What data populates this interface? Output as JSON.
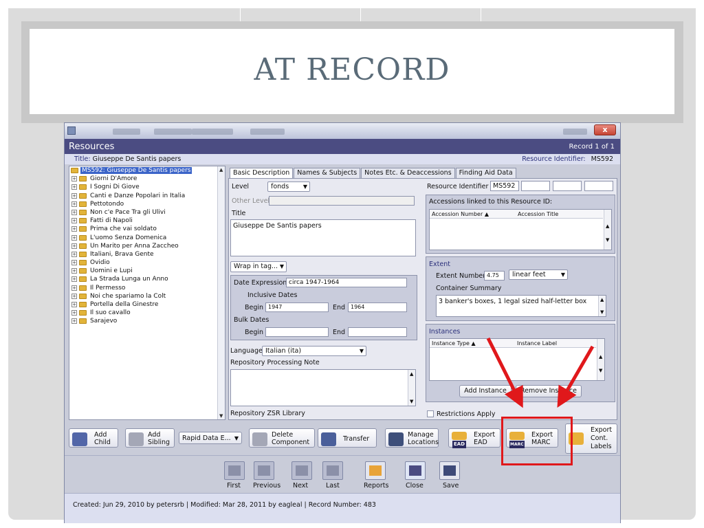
{
  "slide": {
    "title": "AT RECORD"
  },
  "window": {
    "header_title": "Resources",
    "record_indicator": "Record 1 of 1",
    "title_label": "Title:",
    "title_value": "Giuseppe De Santis papers",
    "resource_id_label": "Resource Identifier:",
    "resource_id_value": "MS592",
    "close_glyph": "x"
  },
  "tree": {
    "root": "MS592: Giuseppe De Santis papers",
    "items": [
      "Giorni D'Amore",
      "I Sogni Di Giove",
      "Canti e Danze Popolari in Italia",
      "Pettotondo",
      "Non c'e Pace Tra gli Ulivi",
      "Fatti di Napoli",
      "Prima che vai soldato",
      "L'uomo Senza Domenica",
      "Un Marito per Anna Zaccheo",
      "Italiani, Brava Gente",
      "Ovidio",
      "Uomini e Lupi",
      "La Strada Lunga un Anno",
      "Il Permesso",
      "Noi che spariamo la Colt",
      "Portella della Ginestre",
      "Il suo cavallo",
      "Sarajevo"
    ]
  },
  "tabs": [
    "Basic Description",
    "Names & Subjects",
    "Notes Etc. & Deaccessions",
    "Finding Aid Data"
  ],
  "form": {
    "level_label": "Level",
    "level_value": "fonds",
    "other_level_label": "Other Level",
    "title_label": "Title",
    "title_value": "Giuseppe De Santis papers",
    "wrap_label": "Wrap in tag...",
    "date_expression_label": "Date Expression",
    "date_expression_value": "circa 1947-1964",
    "inclusive_dates_label": "Inclusive Dates",
    "begin_label": "Begin",
    "begin_value": "1947",
    "end_label": "End",
    "end_value": "1964",
    "bulk_dates_label": "Bulk Dates",
    "bulk_begin_label": "Begin",
    "bulk_end_label": "End",
    "language_label": "Language",
    "language_value": "Italian (ita)",
    "repo_note_label": "Repository Processing Note",
    "repository_label": "Repository ZSR Library",
    "resource_identifier_label": "Resource Identifier",
    "resource_identifier_value": "MS592",
    "accessions_title": "Accessions linked to this Resource ID:",
    "accession_number_col": "Accession Number",
    "accession_title_col": "Accession Title",
    "extent_title": "Extent",
    "extent_number_label": "Extent Number",
    "extent_number_value": "4.75",
    "extent_unit_value": "linear feet",
    "container_summary_label": "Container Summary",
    "container_summary_value": "3 banker's boxes, 1 legal sized half-letter box",
    "instances_title": "Instances",
    "instance_type_col": "Instance Type",
    "instance_label_col": "Instance Label",
    "add_instance": "Add Instance",
    "remove_instance": "Remove Instance",
    "restrictions_label": "Restrictions Apply"
  },
  "toolbar": {
    "add_child": [
      "Add",
      "Child"
    ],
    "add_sibling": [
      "Add",
      "Sibling"
    ],
    "rapid_data": "Rapid Data E...",
    "delete_component": [
      "Delete",
      "Component"
    ],
    "transfer": "Transfer",
    "manage_locations": [
      "Manage",
      "Locations"
    ],
    "export_ead": [
      "Export",
      "EAD"
    ],
    "export_marc": [
      "Export",
      "MARC"
    ],
    "export_labels": [
      "Export",
      "Cont.",
      "Labels"
    ],
    "ead_badge": "EAD",
    "marc_badge": "MARC"
  },
  "nav": {
    "first": "First",
    "previous": "Previous",
    "next": "Next",
    "last": "Last",
    "reports": "Reports",
    "close": "Close",
    "save": "Save"
  },
  "status": "Created: Jun 29, 2010 by petersrb | Modified: Mar 28, 2011 by eagleal | Record Number: 483",
  "colors": {
    "header": "#4b4c82",
    "annotation": "#e0181b",
    "selection": "#3b64c8"
  }
}
